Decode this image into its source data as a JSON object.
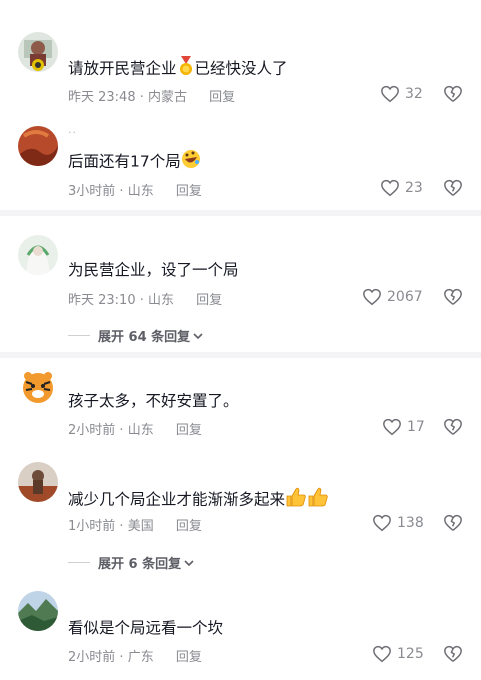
{
  "comments": [
    {
      "text": "请放开民营企业",
      "suffix": "已经快没人了",
      "emoji": "medal",
      "time": "昨天 23:48",
      "location": "内蒙古",
      "reply_label": "回复",
      "likes": "32"
    },
    {
      "text": "后面还有17个局",
      "suffix": "",
      "emoji": "rofl",
      "time": "3小时前",
      "location": "山东",
      "reply_label": "回复",
      "likes": "23"
    },
    {
      "text": "为民营企业，设了一个局",
      "suffix": "",
      "emoji": "",
      "time": "昨天 23:10",
      "location": "山东",
      "reply_label": "回复",
      "likes": "2067",
      "expand": "展开 64 条回复"
    },
    {
      "text": "孩子太多，不好安置了。",
      "suffix": "",
      "emoji": "",
      "time": "2小时前",
      "location": "山东",
      "reply_label": "回复",
      "likes": "17"
    },
    {
      "text": "减少几个局企业才能渐渐多起来",
      "suffix": "",
      "emoji": "thumbs-up",
      "time": "1小时前",
      "location": "美国",
      "reply_label": "回复",
      "likes": "138",
      "expand": "展开 6 条回复"
    },
    {
      "text": "看似是个局远看一个坎",
      "suffix": "",
      "emoji": "",
      "time": "2小时前",
      "location": "广东",
      "reply_label": "回复",
      "likes": "125"
    }
  ],
  "meta_separator": " · ",
  "icons": {
    "like": "heart-outline-icon",
    "dislike": "broken-heart-icon",
    "expand": "chevron-down-icon"
  },
  "colors": {
    "text": "#161823",
    "meta": "#8a8b91",
    "expand": "#5d5e66",
    "separator": "#f4f4f6"
  }
}
